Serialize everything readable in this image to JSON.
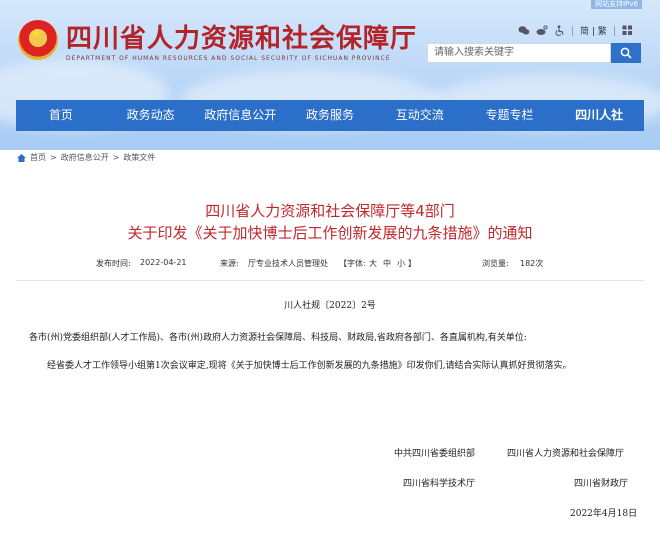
{
  "header": {
    "corner_tag": "网站支持IPv6",
    "site_title": "四川省人力资源和社会保障厅",
    "site_subtitle": "DEPARTMENT OF HUMAN RESOURCES AND SOCIAL SECURITY OF SICHUAN PROVINCE",
    "lang_switch": "简 | 繁",
    "search_placeholder": "请输入搜索关键字"
  },
  "nav": {
    "items": [
      {
        "label": "首页"
      },
      {
        "label": "政务动态"
      },
      {
        "label": "政府信息公开"
      },
      {
        "label": "政务服务"
      },
      {
        "label": "互动交流"
      },
      {
        "label": "专题专栏"
      },
      {
        "label": "四川人社"
      }
    ]
  },
  "breadcrumb": {
    "items": [
      "首页",
      "政府信息公开",
      "政策文件"
    ],
    "separator": ">"
  },
  "article": {
    "title_line1": "四川省人力资源和社会保障厅等4部门",
    "title_line2": "关于印发《关于加快博士后工作创新发展的九条措施》的通知",
    "publish_label": "发布时间:",
    "publish_date": "2022-04-21",
    "source_label": "来源:",
    "source_value": "厅专业技术人员管理处",
    "font_label": "【字体:",
    "font_sizes": [
      "大",
      "中",
      "小"
    ],
    "font_close": "】",
    "views_label": "浏览量:",
    "views_value": "182次",
    "doc_number": "川人社规〔2022〕2号",
    "recipients": "各市(州)党委组织部(人才工作局)、各市(州)政府人力资源社会保障局、科技局、财政局,省政府各部门、各直属机构,有关单位:",
    "body": "经省委人才工作领导小组第1次会议审定,现将《关于加快博士后工作创新发展的九条措施》印发你们,请结合实际认真抓好贯彻落实。",
    "signatories": [
      "中共四川省委组织部",
      "四川省人力资源和社会保障厅",
      "四川省科学技术厅",
      "四川省财政厅"
    ],
    "date": "2022年4月18日"
  },
  "colors": {
    "brand_red": "#b3242a",
    "title_red": "#c0282d",
    "nav_blue": "#2c6fc8",
    "search_blue": "#2f70c8"
  }
}
